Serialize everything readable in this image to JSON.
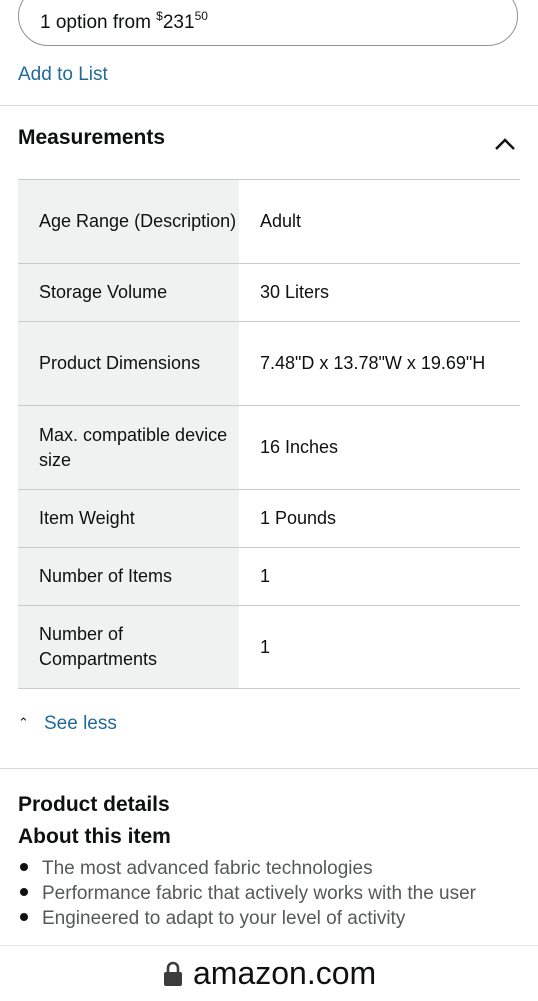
{
  "options": {
    "text": "1 option from ",
    "currency": "$",
    "whole": "231",
    "fraction": "50"
  },
  "add_to_list": "Add to List",
  "measurements": {
    "title": "Measurements",
    "rows": [
      {
        "key": "Age Range (Description)",
        "value": "Adult"
      },
      {
        "key": "Storage Volume",
        "value": "30 Liters"
      },
      {
        "key": "Product Dimensions",
        "value": "7.48\"D x 13.78\"W x 19.69\"H"
      },
      {
        "key": "Max. compatible device size",
        "value": "16 Inches"
      },
      {
        "key": "Item Weight",
        "value": "1 Pounds"
      },
      {
        "key": "Number of Items",
        "value": "1"
      },
      {
        "key": "Number of Compartments",
        "value": "1"
      }
    ],
    "see_less": "See less"
  },
  "product_details": {
    "title": "Product details",
    "about_title": "About this item",
    "bullets": [
      "The most advanced fabric technologies",
      "Performance fabric that actively works with the user",
      "Engineered to adapt to your level of activity"
    ]
  },
  "browser": {
    "domain": "amazon.com"
  },
  "icons": {
    "collapse": "chevron-up-icon",
    "lock": "lock-icon"
  },
  "colors": {
    "link": "#1f6a9a",
    "text": "#0f1111",
    "row_key_bg": "#f0f2f2"
  }
}
